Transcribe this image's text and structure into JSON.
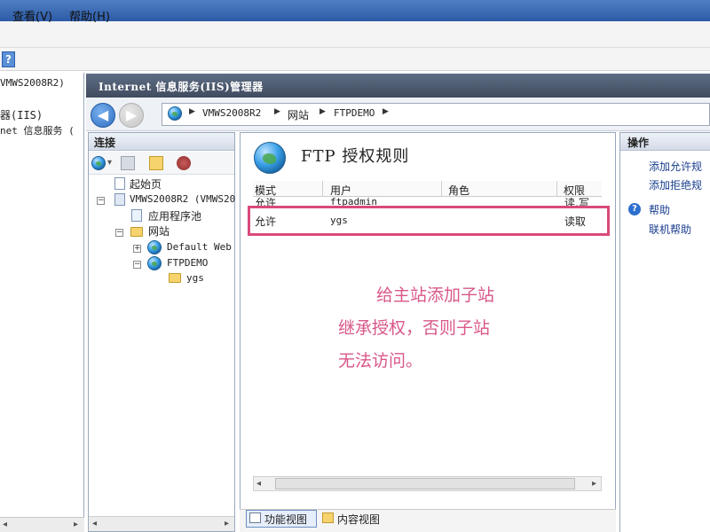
{
  "menu": {
    "view": "查看(V)",
    "help": "帮助(H)"
  },
  "toolbar": {
    "help_glyph": "?"
  },
  "outer_tree": {
    "line1": "VMWS2008R2)",
    "line2": "器(IIS)",
    "line3": "net 信息服务 ("
  },
  "iis": {
    "title": "Internet 信息服务(IIS)管理器"
  },
  "breadcrumb": {
    "server": "VMWS2008R2",
    "sites": "网站",
    "site": "FTPDEMO"
  },
  "connections": {
    "title": "连接",
    "start_page": "起始页",
    "server": "VMWS2008R2 (VMWS20",
    "app_pools": "应用程序池",
    "sites": "网站",
    "default_site": "Default Web",
    "ftp_site": "FTPDEMO",
    "subsite": "ygs"
  },
  "content": {
    "title": "FTP 授权规则",
    "columns": {
      "mode": "模式",
      "user": "用户",
      "role": "角色",
      "permission": "权限"
    },
    "rows": [
      {
        "mode": "允许",
        "user": "ftpadmin",
        "role": "",
        "permission": "读,写"
      },
      {
        "mode": "允许",
        "user": "ygs",
        "role": "",
        "permission": "读取"
      }
    ],
    "annotation": [
      "给主站添加子站",
      "继承授权，否则子站",
      "无法访问。"
    ]
  },
  "views": {
    "features": "功能视图",
    "content": "内容视图"
  },
  "actions": {
    "title": "操作",
    "add_allow": "添加允许规",
    "add_deny": "添加拒绝规",
    "help": "帮助",
    "online_help": "联机帮助"
  },
  "colors": {
    "highlight": "#d94a7c",
    "annotation": "#d9578a",
    "header": "#4a576b"
  }
}
